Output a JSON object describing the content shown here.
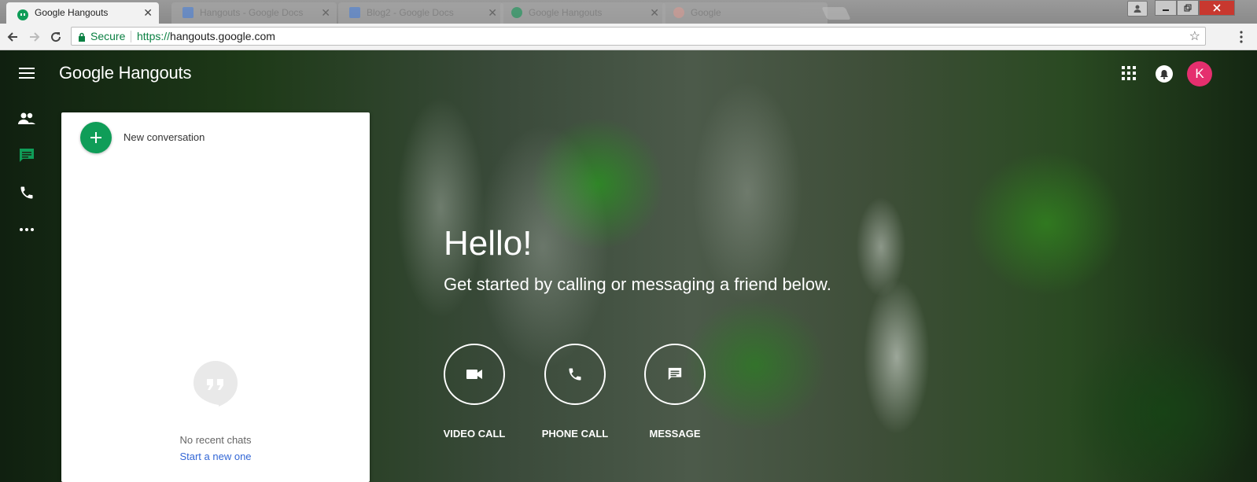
{
  "browser": {
    "tabs": [
      {
        "title": "Google Hangouts",
        "active": true
      },
      {
        "title": "Hangouts - Google Docs",
        "active": false
      },
      {
        "title": "Blog2 - Google Docs",
        "active": false
      },
      {
        "title": "Google Hangouts",
        "active": false
      },
      {
        "title": "Google",
        "active": false
      }
    ],
    "address": {
      "secure_label": "Secure",
      "scheme": "https://",
      "host": "hangouts.google.com"
    }
  },
  "app": {
    "brand_google": "Google",
    "brand_product": "Hangouts",
    "avatar_letter": "K",
    "avatar_color": "#e52f6e",
    "accent_color": "#0f9d58",
    "left_nav": [
      {
        "icon": "contacts-icon"
      },
      {
        "icon": "chat-icon",
        "active": true
      },
      {
        "icon": "phone-icon"
      },
      {
        "icon": "more-icon"
      }
    ]
  },
  "panel": {
    "new_conversation": "New conversation",
    "no_recent": "No recent chats",
    "start_new": "Start a new one"
  },
  "hero": {
    "title": "Hello!",
    "subtitle": "Get started by calling or messaging a friend below.",
    "actions": [
      {
        "label": "VIDEO CALL",
        "icon": "video-camera-icon"
      },
      {
        "label": "PHONE CALL",
        "icon": "phone-icon"
      },
      {
        "label": "MESSAGE",
        "icon": "message-icon"
      }
    ]
  }
}
